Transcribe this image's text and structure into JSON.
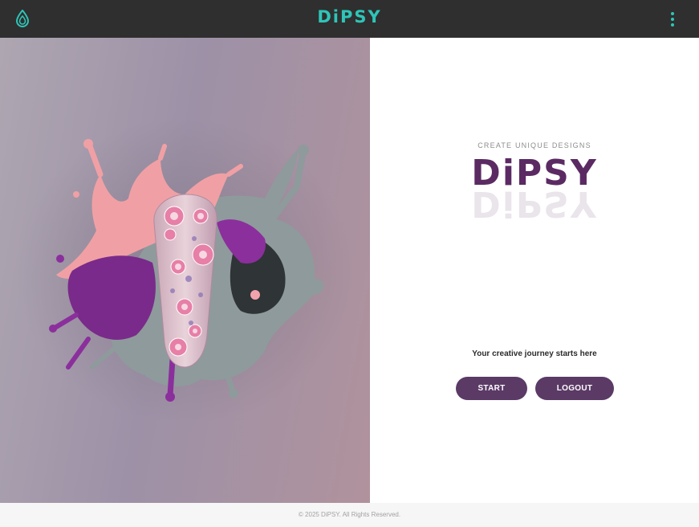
{
  "header": {
    "app_title": "DiPSY",
    "logo_icon": "drop-logo-icon",
    "menu_icon": "more-vertical-icon",
    "accent_color": "#2ec5b8",
    "background_color": "#2f2f2f"
  },
  "hero": {
    "image": "nail-art-paint-splash"
  },
  "main": {
    "tagline": "CREATE UNIQUE DESIGNS",
    "brand": "DiPSY",
    "subtitle": "Your creative journey starts here",
    "start_label": "START",
    "logout_label": "LOGOUT",
    "brand_color": "#5b2a63",
    "button_color": "#5b3a66"
  },
  "footer": {
    "copyright": "© 2025 DiPSY. All Rights Reserved."
  }
}
